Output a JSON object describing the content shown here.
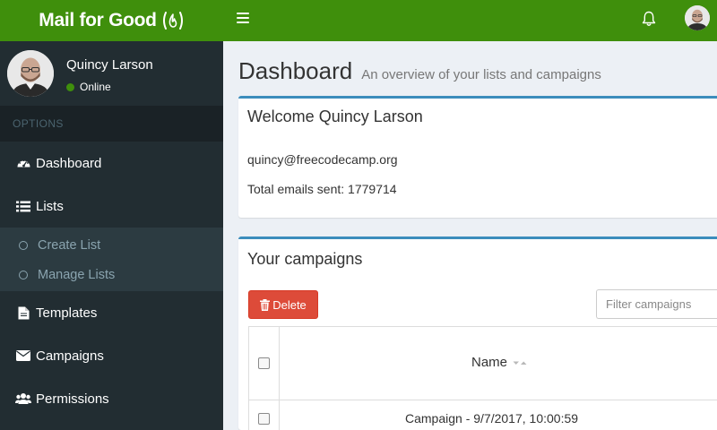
{
  "header": {
    "app_title": "Mail for Good",
    "menu_icon": "hamburger-icon",
    "notifications_icon": "bell-icon",
    "brand_color": "#3f8f0c"
  },
  "sidebar": {
    "user": {
      "name": "Quincy Larson",
      "status": "Online"
    },
    "section_header": "OPTIONS",
    "items": [
      {
        "label": "Dashboard",
        "icon": "dashboard-icon"
      },
      {
        "label": "Lists",
        "icon": "list-icon",
        "expanded": true,
        "children": [
          {
            "label": "Create List"
          },
          {
            "label": "Manage Lists"
          }
        ]
      },
      {
        "label": "Templates",
        "icon": "file-icon"
      },
      {
        "label": "Campaigns",
        "icon": "envelope-icon"
      },
      {
        "label": "Permissions",
        "icon": "users-icon"
      }
    ]
  },
  "page": {
    "title": "Dashboard",
    "subtitle": "An overview of your lists and campaigns"
  },
  "welcome": {
    "title": "Welcome Quincy Larson",
    "email": "quincy@freecodecamp.org",
    "total_emails": "Total emails sent: 1779714"
  },
  "campaigns": {
    "title": "Your campaigns",
    "delete_label": "Delete",
    "filter_placeholder": "Filter campaigns",
    "columns": [
      "Name"
    ],
    "rows": [
      {
        "name": "Campaign - 9/7/2017, 10:00:59"
      }
    ]
  }
}
